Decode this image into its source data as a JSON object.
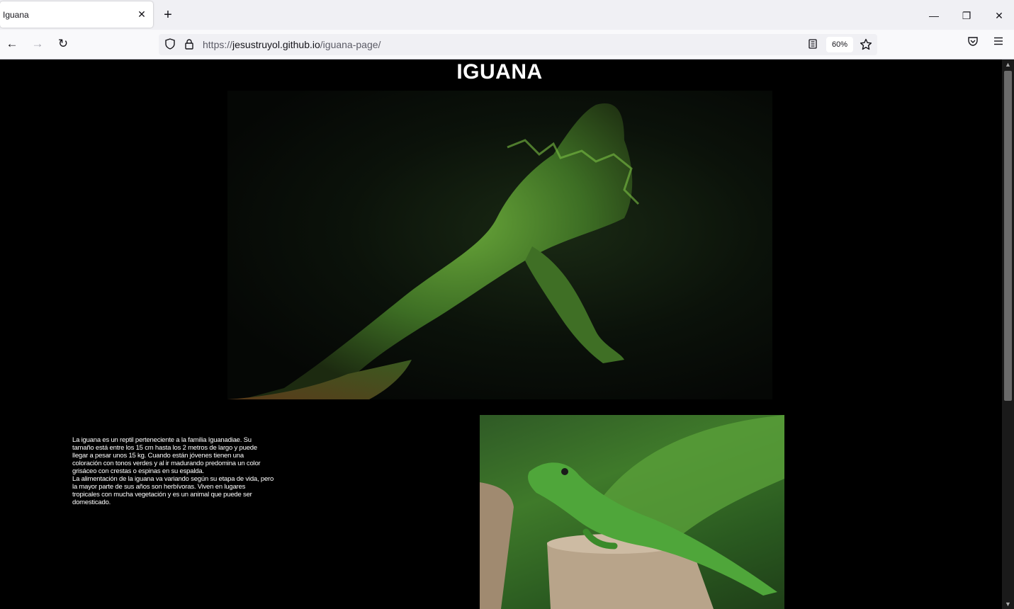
{
  "browser": {
    "tab_title": "Iguana",
    "tab_close": "✕",
    "new_tab": "+",
    "window": {
      "minimize": "—",
      "restore": "❐",
      "close": "✕"
    },
    "nav": {
      "back": "←",
      "forward": "→",
      "reload": "↻"
    },
    "url": {
      "scheme": "https://",
      "host": "jesustruyol.github.io",
      "path": "/iguana-page/"
    },
    "zoom": "60%",
    "icons": {
      "shield": "shield-icon",
      "lock": "lock-icon",
      "reader": "reader-mode-icon",
      "star": "bookmark-star-icon",
      "pocket": "pocket-icon",
      "menu": "hamburger-menu-icon"
    }
  },
  "page": {
    "title": "IGUANA",
    "description": [
      "La iguana es un reptil perteneciente a la familia Iguanadiae. Su tamaño está entre los 15 cm hasta los 2 metros de largo y puede llegar a pesar unos 15 kg. Cuando están jóvenes tienen una coloración con tonos verdes y al ir madurando predomina un color grisáceo con crestas o espinas en su espalda.",
      "La alimentación de la iguana va variando según su etapa de vida, pero la mayor parte de sus años son herbívoras. Viven en lugares tropicales con mucha vegetación y es un animal que puede ser domesticado."
    ]
  },
  "colors": {
    "page_bg": "#000000",
    "text": "#ffffff",
    "chrome_bg": "#f0f0f4"
  }
}
